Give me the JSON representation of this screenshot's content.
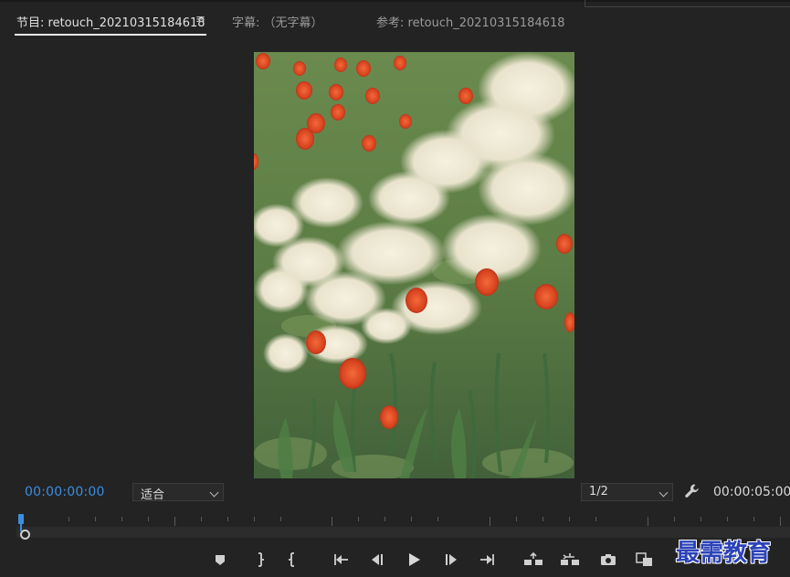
{
  "tabs": [
    {
      "label": "节目: retouch_20210315184618",
      "active": true
    },
    {
      "label": "字幕: （无字幕）",
      "active": false
    },
    {
      "label": "参考: retouch_20210315184618",
      "active": false
    }
  ],
  "tab_menu_glyph": "≡",
  "controls": {
    "timecode_current": "00:00:00:00",
    "timecode_duration": "00:00:05:00",
    "zoom_select": "适合",
    "resolution_select": "1/2"
  },
  "transport_icons": [
    "add-marker-icon",
    "mark-in-icon",
    "mark-out-icon",
    "go-to-in-icon",
    "step-back-icon",
    "play-icon",
    "step-forward-icon",
    "go-to-out-icon",
    "lift-icon",
    "extract-icon",
    "export-frame-icon",
    "comparison-view-icon"
  ],
  "watermark": "最需教育",
  "colors": {
    "background": "#232323",
    "accent_blue": "#3b8ee0",
    "watermark_blue": "#2c43b8"
  }
}
